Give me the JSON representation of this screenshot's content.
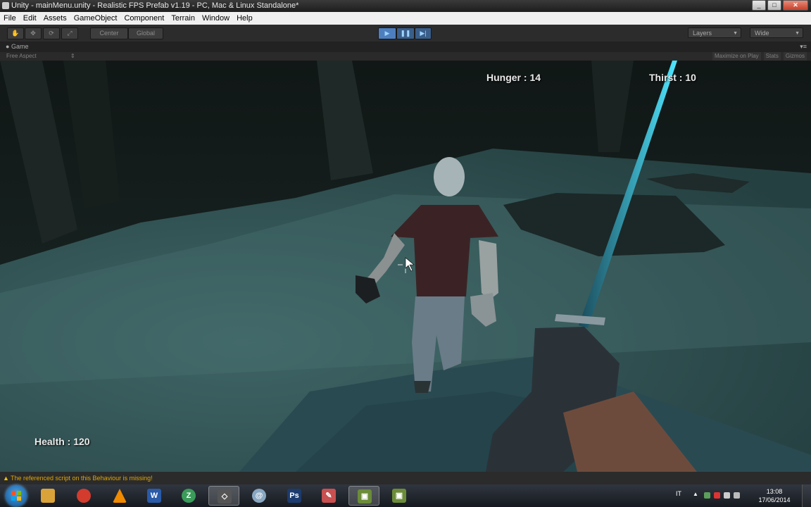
{
  "window": {
    "title": "Unity - mainMenu.unity - Realistic FPS Prefab v1.19 - PC, Mac & Linux Standalone*",
    "buttons": {
      "minimize": "_",
      "maximize": "□",
      "close": "✕"
    }
  },
  "menu": [
    "File",
    "Edit",
    "Assets",
    "GameObject",
    "Component",
    "Terrain",
    "Window",
    "Help"
  ],
  "toolbar": {
    "tools": [
      {
        "name": "hand-tool-icon",
        "glyph": "✋"
      },
      {
        "name": "move-tool-icon",
        "glyph": "✥"
      },
      {
        "name": "rotate-tool-icon",
        "glyph": "⟳"
      },
      {
        "name": "scale-tool-icon",
        "glyph": "⤢"
      }
    ],
    "pivot_label": "Center",
    "space_label": "Global",
    "play_glyph": "▶",
    "pause_glyph": "❚❚",
    "step_glyph": "▶|",
    "layers_label": "Layers",
    "layout_label": "Wide"
  },
  "game_panel": {
    "tab_label": "Game",
    "aspect_label": "Free Aspect",
    "maximize_label": "Maximize on Play",
    "stats_label": "Stats",
    "gizmos_label": "Gizmos"
  },
  "hud": {
    "hunger": "Hunger : 14",
    "thirst": "Thirst : 10",
    "health": "Health : 120"
  },
  "console": {
    "message": "The referenced script on this Behaviour is missing!"
  },
  "taskbar": {
    "apps": [
      {
        "name": "explorer-icon",
        "label": "",
        "color": "#d9a33a"
      },
      {
        "name": "chrome-icon",
        "label": "",
        "color": "#d33b2c"
      },
      {
        "name": "vlc-icon",
        "label": "",
        "color": "#f08a00"
      },
      {
        "name": "word-icon",
        "label": "W",
        "color": "#2a5aa8"
      },
      {
        "name": "app-z-icon",
        "label": "Z",
        "color": "#3b9b5a"
      },
      {
        "name": "unity-icon",
        "label": "◇",
        "color": "#555"
      },
      {
        "name": "app-swirl-icon",
        "label": "@",
        "color": "#8aa7c2"
      },
      {
        "name": "photoshop-icon",
        "label": "Ps",
        "color": "#1c3b6e"
      },
      {
        "name": "paint-icon",
        "label": "✎",
        "color": "#c85050"
      },
      {
        "name": "game-icon",
        "label": "▣",
        "color": "#6c8c3a"
      },
      {
        "name": "game2-icon",
        "label": "▣",
        "color": "#6c8c3a"
      }
    ],
    "language": "IT",
    "time": "13:08",
    "date": "17/06/2014"
  }
}
